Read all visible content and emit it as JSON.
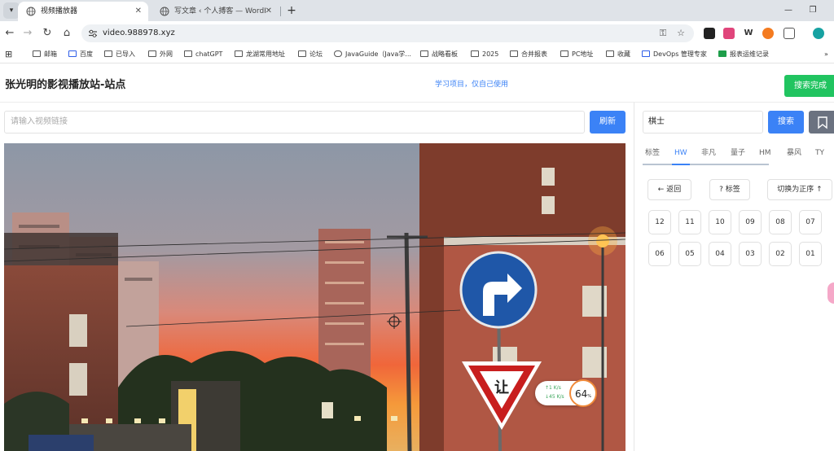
{
  "browser": {
    "tabs": [
      {
        "label": "视频播放器",
        "active": true
      },
      {
        "label": "写文章 ‹ 个人搏客 — WordPre",
        "active": false
      }
    ],
    "address": "video.988978.xyz",
    "bookmarks": [
      "邮箱",
      "百度",
      "已导入",
      "外网",
      "chatGPT",
      "龙湖常用地址",
      "论坛",
      "JavaGuide（Java学...",
      "战略看板",
      "2025",
      "合并报表",
      "PC地址",
      "收藏",
      "DevOps 管理专家",
      "报表运维记录"
    ]
  },
  "page": {
    "title": "张光明的影视播放站-站点",
    "notice": "学习项目，仅自己使用",
    "done_label": "搜索完成",
    "url_placeholder": "请输入视频链接",
    "refresh_label": "刷新",
    "keyword_value": "棋士",
    "search_label": "搜索",
    "source_tabs": [
      "标签",
      "HW",
      "非凡",
      "量子",
      "HM",
      "暴风",
      "TY"
    ],
    "active_source": "HW",
    "back_label": "← 返回",
    "tag_label": "? 标签",
    "order_label": "切换为正序 ↑",
    "episodes": [
      "12",
      "11",
      "10",
      "09",
      "08",
      "07",
      "06",
      "05",
      "04",
      "03",
      "02",
      "01"
    ]
  },
  "overlay": {
    "speed_up": "↑1  K/s",
    "speed_down": "↓45  K/s",
    "percent": "64",
    "percent_unit": "%"
  },
  "colors": {
    "accent": "#3b82f6",
    "done_green": "#21c460",
    "grey_button": "#6b7280"
  },
  "video_scene": {
    "road_sign_text": "让"
  }
}
